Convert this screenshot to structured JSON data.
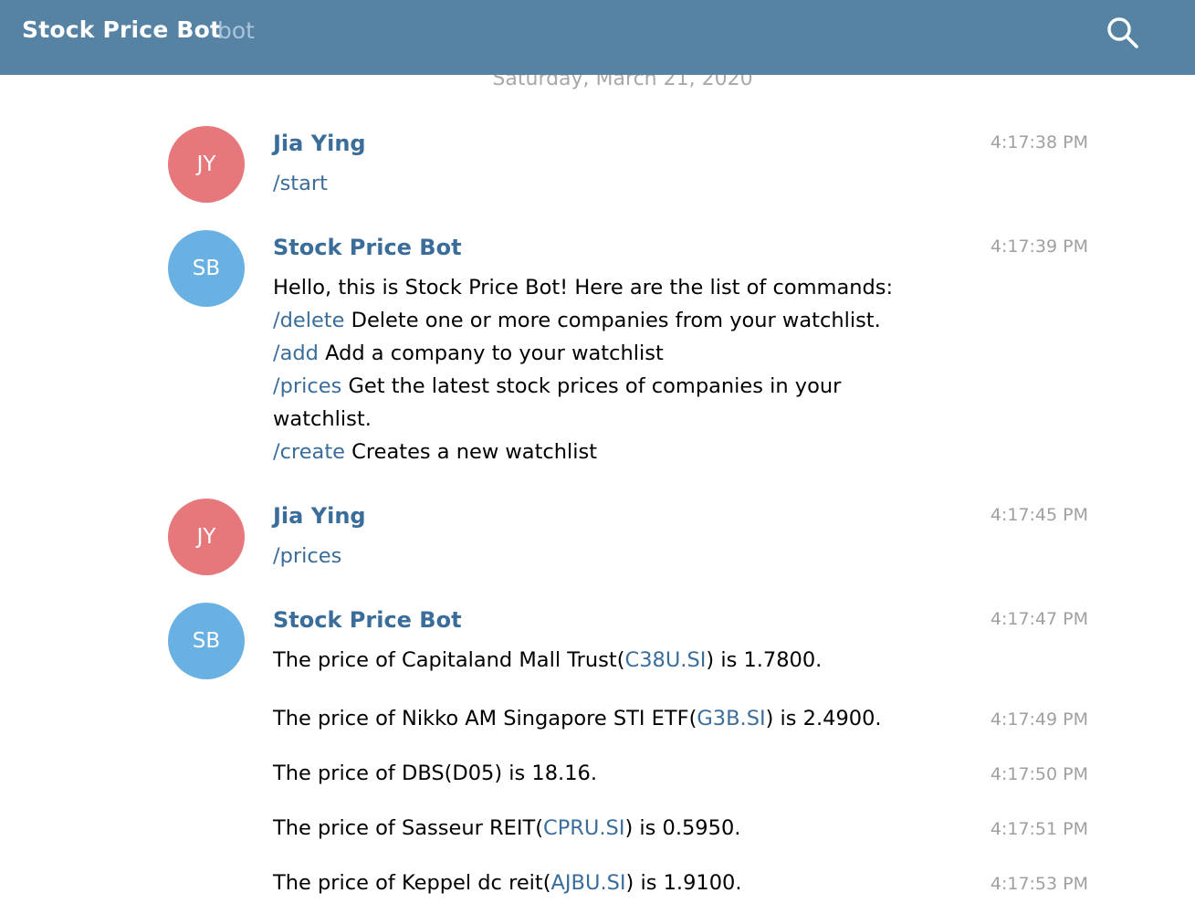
{
  "header": {
    "title": "Stock Price Bot",
    "subtitle": "bot",
    "search_icon": "search-icon"
  },
  "date_separator": "Saturday, March 21, 2020",
  "colors": {
    "header_bg": "#5682a3",
    "author": "#3a6d99",
    "avatar_jy": "#e6777a",
    "avatar_sb": "#6ab1e3"
  },
  "messages": [
    {
      "initials": "JY",
      "author": "Jia Ying",
      "time": "4:17:38 PM",
      "command": "/start"
    },
    {
      "initials": "SB",
      "author": "Stock Price Bot",
      "time": "4:17:39 PM",
      "intro": "Hello, this is Stock Price Bot! Here are the list of commands:",
      "commands": [
        {
          "cmd": "/delete",
          "desc": " Delete one or more companies from your watchlist."
        },
        {
          "cmd": "/add",
          "desc": " Add a company to your watchlist"
        },
        {
          "cmd": "/prices",
          "desc": " Get the latest stock prices of companies in your",
          "desc_cont": "watchlist."
        },
        {
          "cmd": "/create",
          "desc": " Creates a new watchlist"
        }
      ]
    },
    {
      "initials": "JY",
      "author": "Jia Ying",
      "time": "4:17:45 PM",
      "command": "/prices"
    },
    {
      "initials": "SB",
      "author": "Stock Price Bot",
      "time": "4:17:47 PM"
    }
  ],
  "prices": [
    {
      "prefix": "The price of Capitaland Mall Trust(",
      "ticker": "C38U.SI",
      "suffix": ") is 1.7800.",
      "time": "4:17:47 PM"
    },
    {
      "prefix": "The price of Nikko AM Singapore STI ETF(",
      "ticker": "G3B.SI",
      "suffix": ") is 2.4900.",
      "time": "4:17:49 PM"
    },
    {
      "prefix": "The price of DBS(D05) is 18.16.",
      "ticker": "",
      "suffix": "",
      "time": "4:17:50 PM"
    },
    {
      "prefix": "The price of Sasseur REIT(",
      "ticker": "CPRU.SI",
      "suffix": ") is 0.5950.",
      "time": "4:17:51 PM"
    },
    {
      "prefix": "The price of Keppel dc reit(",
      "ticker": "AJBU.SI",
      "suffix": ") is 1.9100.",
      "time": "4:17:53 PM"
    }
  ]
}
